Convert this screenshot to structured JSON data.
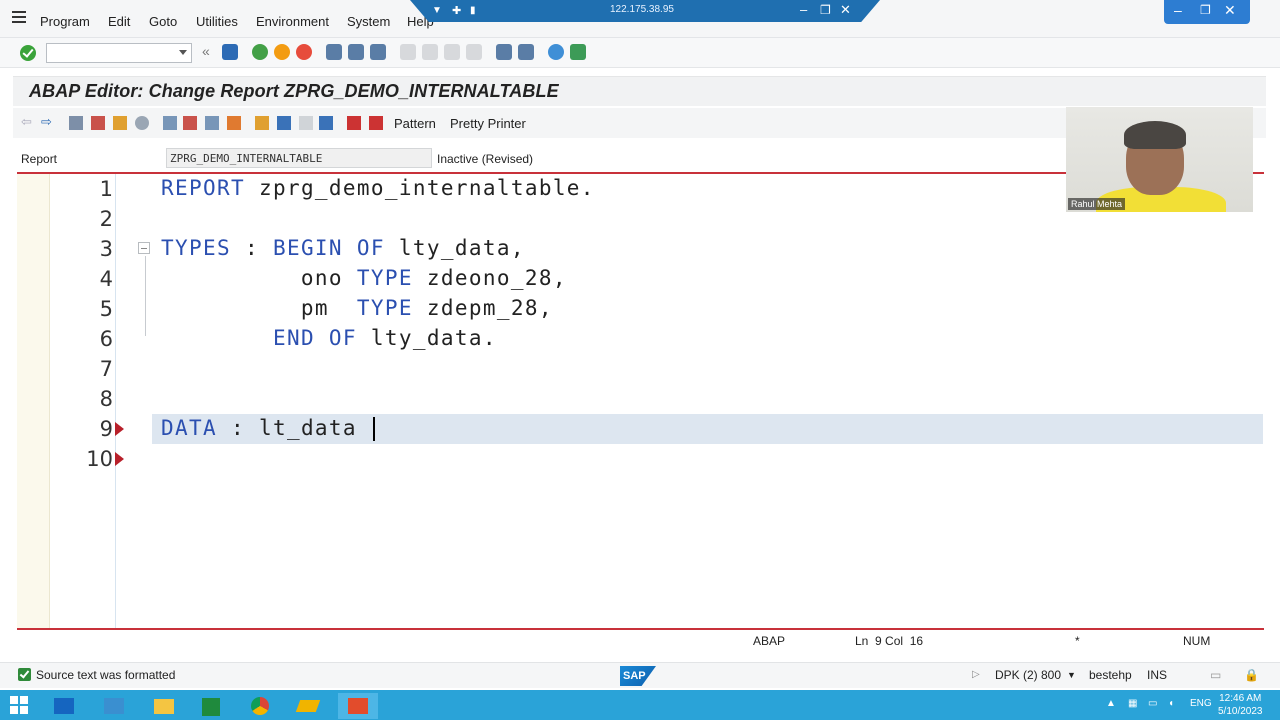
{
  "menu": [
    "Program",
    "Edit",
    "Goto",
    "Utilities",
    "Environment",
    "System",
    "Help"
  ],
  "remote_session": {
    "ip": "122.175.38.95"
  },
  "window_title": "ABAP Editor: Change Report ZPRG_DEMO_INTERNALTABLE",
  "toolbar2": {
    "pattern_label": "Pattern",
    "pretty_printer_label": "Pretty Printer"
  },
  "report": {
    "label": "Report",
    "name": "ZPRG_DEMO_INTERNALTABLE",
    "status": "Inactive (Revised)"
  },
  "code_lines": [
    {
      "n": "1",
      "tokens": [
        [
          "kw",
          "REPORT"
        ],
        [
          "id",
          " zprg_demo_internaltable."
        ]
      ]
    },
    {
      "n": "2",
      "tokens": []
    },
    {
      "n": "3",
      "tokens": [
        [
          "kw",
          "TYPES"
        ],
        [
          "id",
          " : "
        ],
        [
          "kw",
          "BEGIN OF"
        ],
        [
          "id",
          " lty_data,"
        ]
      ]
    },
    {
      "n": "4",
      "tokens": [
        [
          "id",
          "          ono "
        ],
        [
          "kw",
          "TYPE"
        ],
        [
          "id",
          " zdeono_28,"
        ]
      ]
    },
    {
      "n": "5",
      "tokens": [
        [
          "id",
          "          pm  "
        ],
        [
          "kw",
          "TYPE"
        ],
        [
          "id",
          " zdepm_28,"
        ]
      ]
    },
    {
      "n": "6",
      "tokens": [
        [
          "id",
          "        "
        ],
        [
          "kw",
          "END OF"
        ],
        [
          "id",
          " lty_data."
        ]
      ]
    },
    {
      "n": "7",
      "tokens": []
    },
    {
      "n": "8",
      "tokens": []
    },
    {
      "n": "9",
      "tokens": [
        [
          "kw",
          "DATA"
        ],
        [
          "id",
          " : lt_data "
        ]
      ]
    },
    {
      "n": "10",
      "tokens": []
    }
  ],
  "webcam": {
    "name": "Rahul Mehta"
  },
  "status": {
    "language": "ABAP",
    "position": "Ln  9 Col  16",
    "modified": "*",
    "num": "NUM"
  },
  "footer": {
    "message": "Source text was formatted",
    "system": "DPK (2) 800",
    "server": "bestehp",
    "mode": "INS"
  },
  "taskbar": {
    "lang": "ENG",
    "time": "12:46 AM",
    "date": "5/10/2023"
  }
}
